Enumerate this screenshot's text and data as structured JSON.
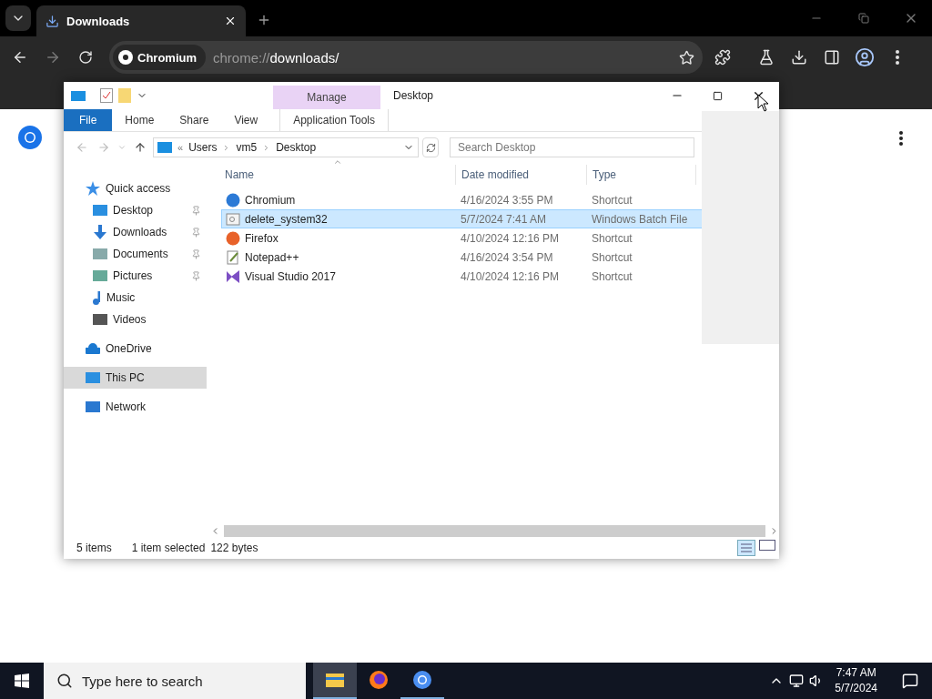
{
  "browser": {
    "tabs": [
      {
        "title": "Downloads",
        "selected": true
      }
    ],
    "address": {
      "chip": "Chromium",
      "url_prefix": "chrome://",
      "url_path": "downloads/"
    }
  },
  "explorer": {
    "title": "Desktop",
    "context_tab": "Manage",
    "ribbon_tabs": [
      {
        "label": "File",
        "kind": "file",
        "selected": false
      },
      {
        "label": "Home",
        "kind": "tab",
        "selected": false
      },
      {
        "label": "Share",
        "kind": "tab",
        "selected": false
      },
      {
        "label": "View",
        "kind": "tab",
        "selected": false
      },
      {
        "label": "Application Tools",
        "kind": "context",
        "selected": false
      }
    ],
    "address_overflow": "«",
    "breadcrumbs": [
      "Users",
      "vm5",
      "Desktop"
    ],
    "search": {
      "placeholder": "Search Desktop"
    },
    "columns": [
      "Name",
      "Date modified",
      "Type"
    ],
    "rows": [
      {
        "name": "Chromium",
        "date": "4/16/2024 3:55 PM",
        "type": "Shortcut",
        "selected": false
      },
      {
        "name": "delete_system32",
        "date": "5/7/2024 7:41 AM",
        "type": "Windows Batch File",
        "selected": true
      },
      {
        "name": "Firefox",
        "date": "4/10/2024 12:16 PM",
        "type": "Shortcut",
        "selected": false
      },
      {
        "name": "Notepad++",
        "date": "4/16/2024 3:54 PM",
        "type": "Shortcut",
        "selected": false
      },
      {
        "name": "Visual Studio 2017",
        "date": "4/10/2024 12:16 PM",
        "type": "Shortcut",
        "selected": false
      }
    ],
    "sidebar": [
      {
        "label": "Quick access",
        "selected": false,
        "children": [
          {
            "label": "Desktop",
            "pinned": true,
            "selected": false
          },
          {
            "label": "Downloads",
            "pinned": true,
            "selected": false
          },
          {
            "label": "Documents",
            "pinned": true,
            "selected": false
          },
          {
            "label": "Pictures",
            "pinned": true,
            "selected": false
          },
          {
            "label": "Music",
            "pinned": false,
            "selected": false
          },
          {
            "label": "Videos",
            "pinned": false,
            "selected": false
          }
        ]
      },
      {
        "label": "OneDrive",
        "selected": false
      },
      {
        "label": "This PC",
        "selected": true
      },
      {
        "label": "Network",
        "selected": false
      }
    ],
    "status": [
      "5 items",
      "1 item selected",
      "122 bytes"
    ]
  },
  "taskbar": {
    "search": {
      "placeholder": "Type here to search"
    },
    "apps": [
      {
        "open": true,
        "active": true
      },
      {
        "open": false,
        "active": false
      },
      {
        "open": true,
        "active": false
      }
    ],
    "time": "7:47 AM",
    "date": "5/7/2024"
  }
}
